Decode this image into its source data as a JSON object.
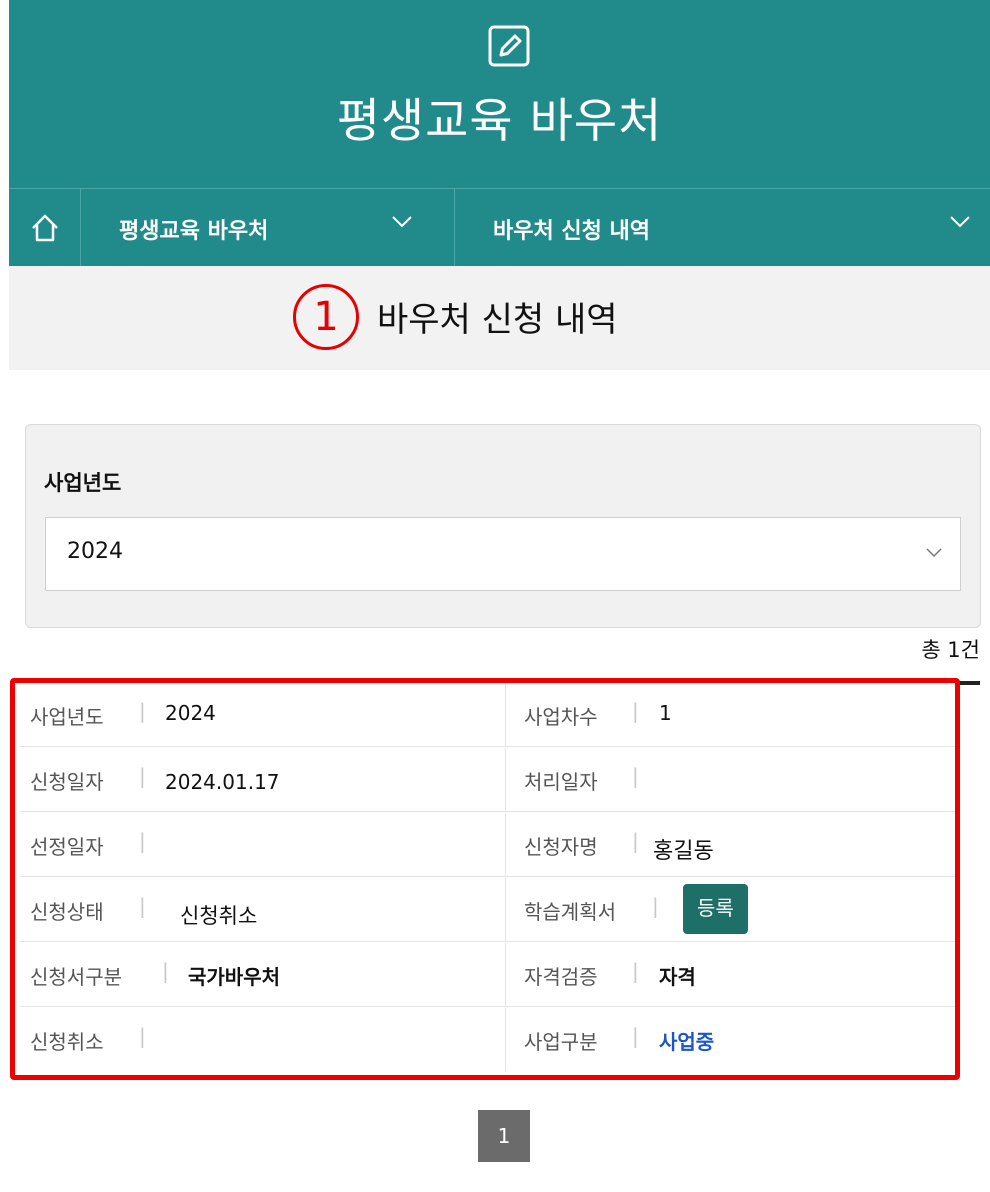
{
  "header": {
    "title": "평생교육 바우처",
    "icon": "edit-icon"
  },
  "nav": {
    "home_icon": "home-icon",
    "menu1": "평생교육 바우처",
    "menu2": "바우처 신청 내역"
  },
  "page": {
    "step_number": "1",
    "title": "바우처 신청 내역"
  },
  "filter": {
    "label": "사업년도",
    "selected_year": "2024"
  },
  "summary": {
    "total": "총 1건"
  },
  "record": {
    "year_label": "사업년도",
    "year_value": "2024",
    "round_label": "사업차수",
    "round_value": "1",
    "apply_date_label": "신청일자",
    "apply_date_value": "2024.01.17",
    "process_date_label": "처리일자",
    "process_date_value": "",
    "select_date_label": "선정일자",
    "select_date_value": "",
    "applicant_label": "신청자명",
    "applicant_value": "홍길동",
    "status_label": "신청상태",
    "status_value": "신청취소",
    "plan_label": "학습계획서",
    "plan_button": "등록",
    "type_label": "신청서구분",
    "type_value": "국가바우처",
    "qual_label": "자격검증",
    "qual_value": "자격",
    "cancel_label": "신청취소",
    "cancel_value": "",
    "biz_label": "사업구분",
    "biz_value": "사업중"
  },
  "pagination": {
    "current": "1"
  },
  "colors": {
    "header": "#218a8a",
    "highlight": "#ee0000",
    "button": "#1f6f69",
    "link": "#1a57c4"
  }
}
